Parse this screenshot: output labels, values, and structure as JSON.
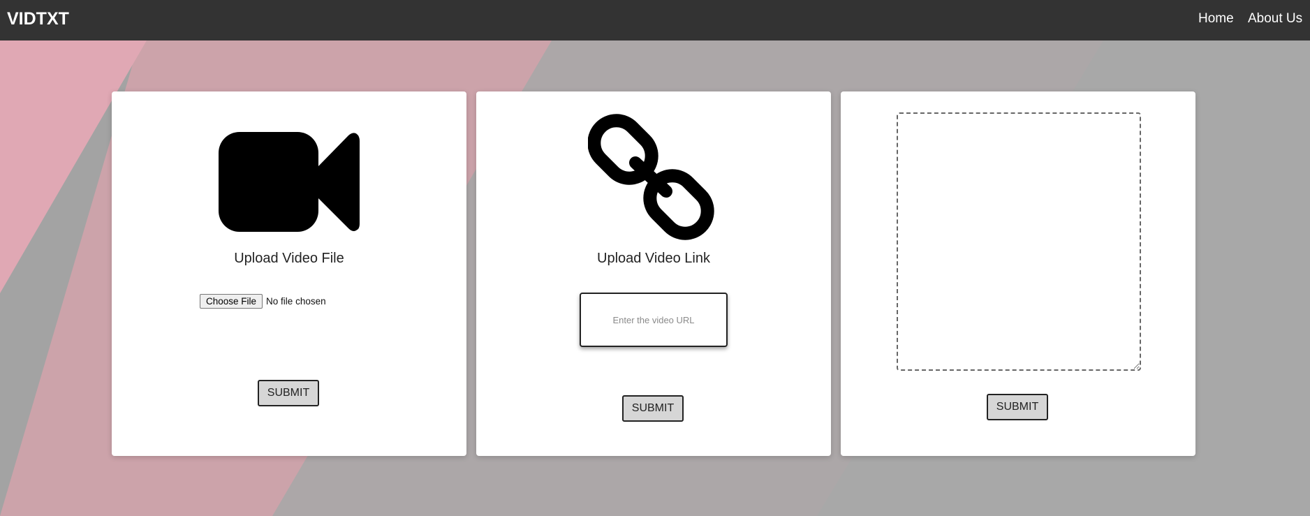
{
  "navbar": {
    "brand": "VIDTXT",
    "links": [
      {
        "label": "Home"
      },
      {
        "label": "About Us"
      }
    ]
  },
  "cards": {
    "file_upload": {
      "icon": "video-camera-icon",
      "title": "Upload Video File",
      "choose_file_label": "Choose File",
      "file_status": "No file chosen",
      "submit_label": "SUBMIT"
    },
    "link_upload": {
      "icon": "link-chain-icon",
      "title": "Upload Video Link",
      "url_placeholder": "Enter the video URL",
      "url_value": "",
      "submit_label": "SUBMIT"
    },
    "text_output": {
      "textarea_value": "",
      "submit_label": "SUBMIT"
    }
  },
  "colors": {
    "navbar_bg": "#333333",
    "background_pink": "#e0a8b4",
    "background_gray": "#a3a3a3",
    "button_bg": "#d6d6d6"
  }
}
